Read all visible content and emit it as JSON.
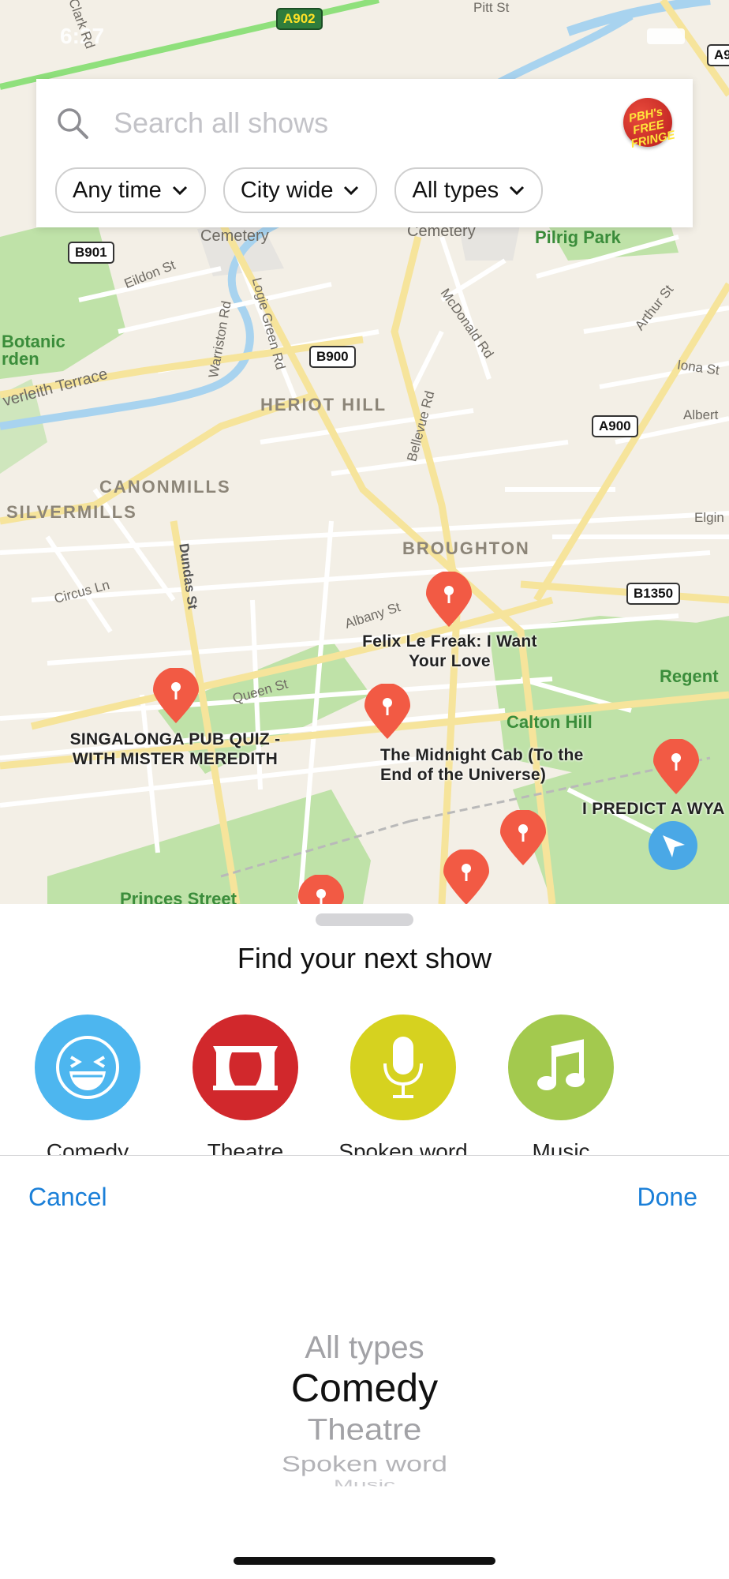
{
  "status": {
    "time": "6:27"
  },
  "search": {
    "placeholder": "Search all shows",
    "logo_text": "PBH's FREE FRINGE"
  },
  "filters": [
    {
      "label": "Any time"
    },
    {
      "label": "City wide"
    },
    {
      "label": "All types"
    }
  ],
  "map": {
    "areas": [
      "HERIOT HILL",
      "CANONMILLS",
      "SILVERMILLS",
      "BROUGHTON"
    ],
    "parks": [
      "Pilrig Park",
      "Botanic",
      "rden",
      "Calton Hill",
      "Regent",
      "Princes Street",
      "Cemetery",
      "Cemetery"
    ],
    "streets": [
      "Clark Rd",
      "Pitt St",
      "Eildon St",
      "Logie Green Rd",
      "Warriston Rd",
      "McDonald Rd",
      "Arthur St",
      "Iona St",
      "Albert",
      "Elgin",
      "Bellevue Rd",
      "verleith Terrace",
      "Circus Ln",
      "Dundas St",
      "Albany St",
      "Queen St"
    ],
    "road_shields": [
      "A902",
      "B901",
      "B900",
      "A900",
      "B1350",
      "A9"
    ],
    "pins": [
      {
        "label": "Felix Le Freak: I Want Your Love"
      },
      {
        "label": "SINGALONGA PUB QUIZ - WITH MISTER MEREDITH"
      },
      {
        "label": "The Midnight Cab (To the End of the Universe)"
      },
      {
        "label": "I PREDICT A WYA"
      }
    ],
    "colors": {
      "pin": "#f25a44",
      "park": "#bfe2a8",
      "road": "#ffffff",
      "major_road": "#f6e49b"
    }
  },
  "sheet": {
    "title": "Find your next show",
    "categories": [
      {
        "label": "Comedy",
        "icon": "laughing-face-icon",
        "color": "#4db6ef"
      },
      {
        "label": "Theatre",
        "icon": "curtains-icon",
        "color": "#d1282c"
      },
      {
        "label": "Spoken word",
        "icon": "microphone-icon",
        "color": "#d6d21f"
      },
      {
        "label": "Music",
        "icon": "music-note-icon",
        "color": "#a3c94e"
      }
    ]
  },
  "toolbar": {
    "cancel": "Cancel",
    "done": "Done"
  },
  "picker": {
    "options": [
      "All types",
      "Comedy",
      "Theatre",
      "Spoken word",
      "Music"
    ],
    "selected": "Comedy"
  }
}
